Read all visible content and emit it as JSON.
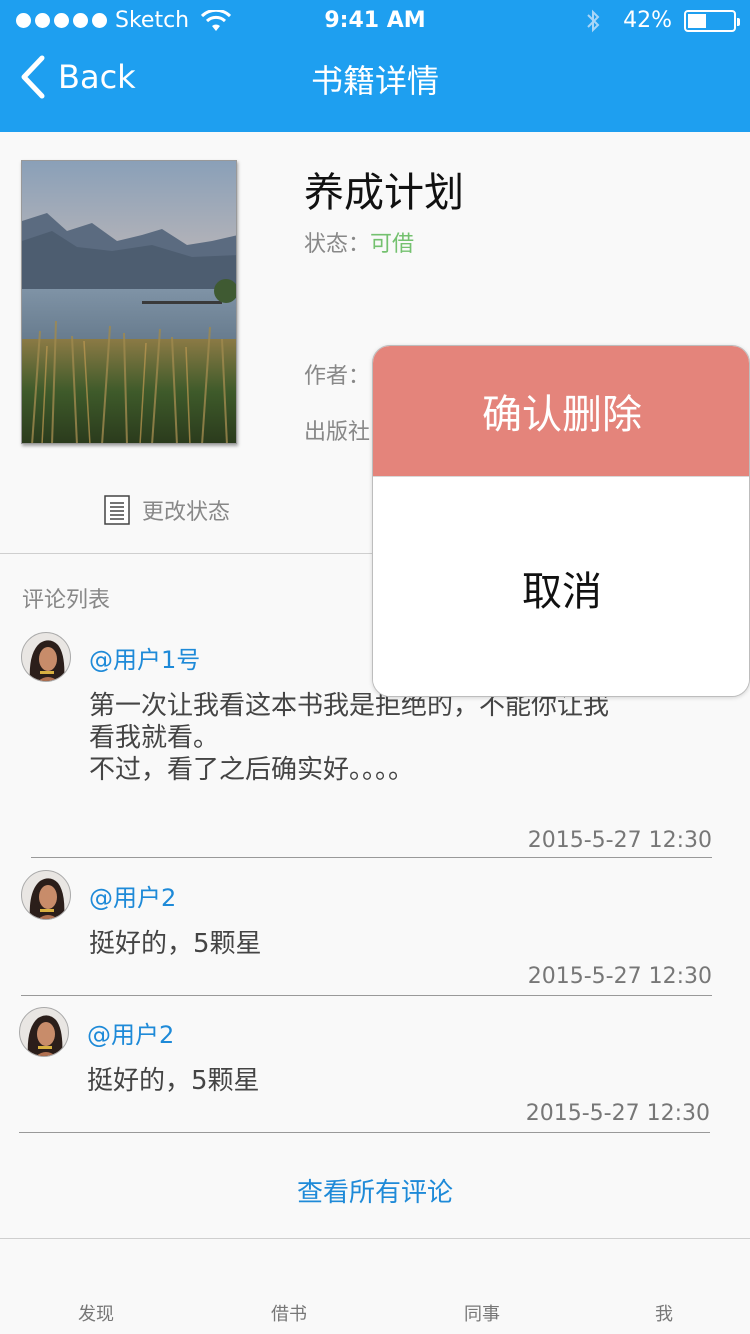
{
  "status_bar": {
    "carrier": "Sketch",
    "time": "9:41 AM",
    "battery_percent": "42%",
    "battery_level": 0.42,
    "icons": [
      "signal-dots-icon",
      "wifi-icon",
      "bluetooth-icon",
      "battery-icon"
    ]
  },
  "nav": {
    "back_label": "Back",
    "title": "书籍详情"
  },
  "book": {
    "title": "养成计划",
    "status_label": "状态：",
    "status_value": "可借",
    "author_label": "作者：",
    "publisher_label": "出版社",
    "change_status_label": "更改状态"
  },
  "comments": {
    "heading": "评论列表",
    "items": [
      {
        "user": "@用户1号",
        "text": "第一次让我看这本书我是拒绝的，不能你让我\n看我就看。\n不过，看了之后确实好。。。。",
        "time": "2015-5-27 12:30"
      },
      {
        "user": "@用户2",
        "text": "挺好的，5颗星",
        "time": "2015-5-27 12:30"
      },
      {
        "user": "@用户2",
        "text": "挺好的，5颗星",
        "time": "2015-5-27 12:30"
      }
    ],
    "view_all": "查看所有评论"
  },
  "tabs": [
    "发现",
    "借书",
    "同事",
    "我"
  ],
  "popup": {
    "confirm_label": "确认删除",
    "cancel_label": "取消"
  },
  "colors": {
    "header": "#1e9ff0",
    "status_available": "#74c16f",
    "link": "#1e8ad8",
    "confirm_bg": "#e4847b"
  }
}
